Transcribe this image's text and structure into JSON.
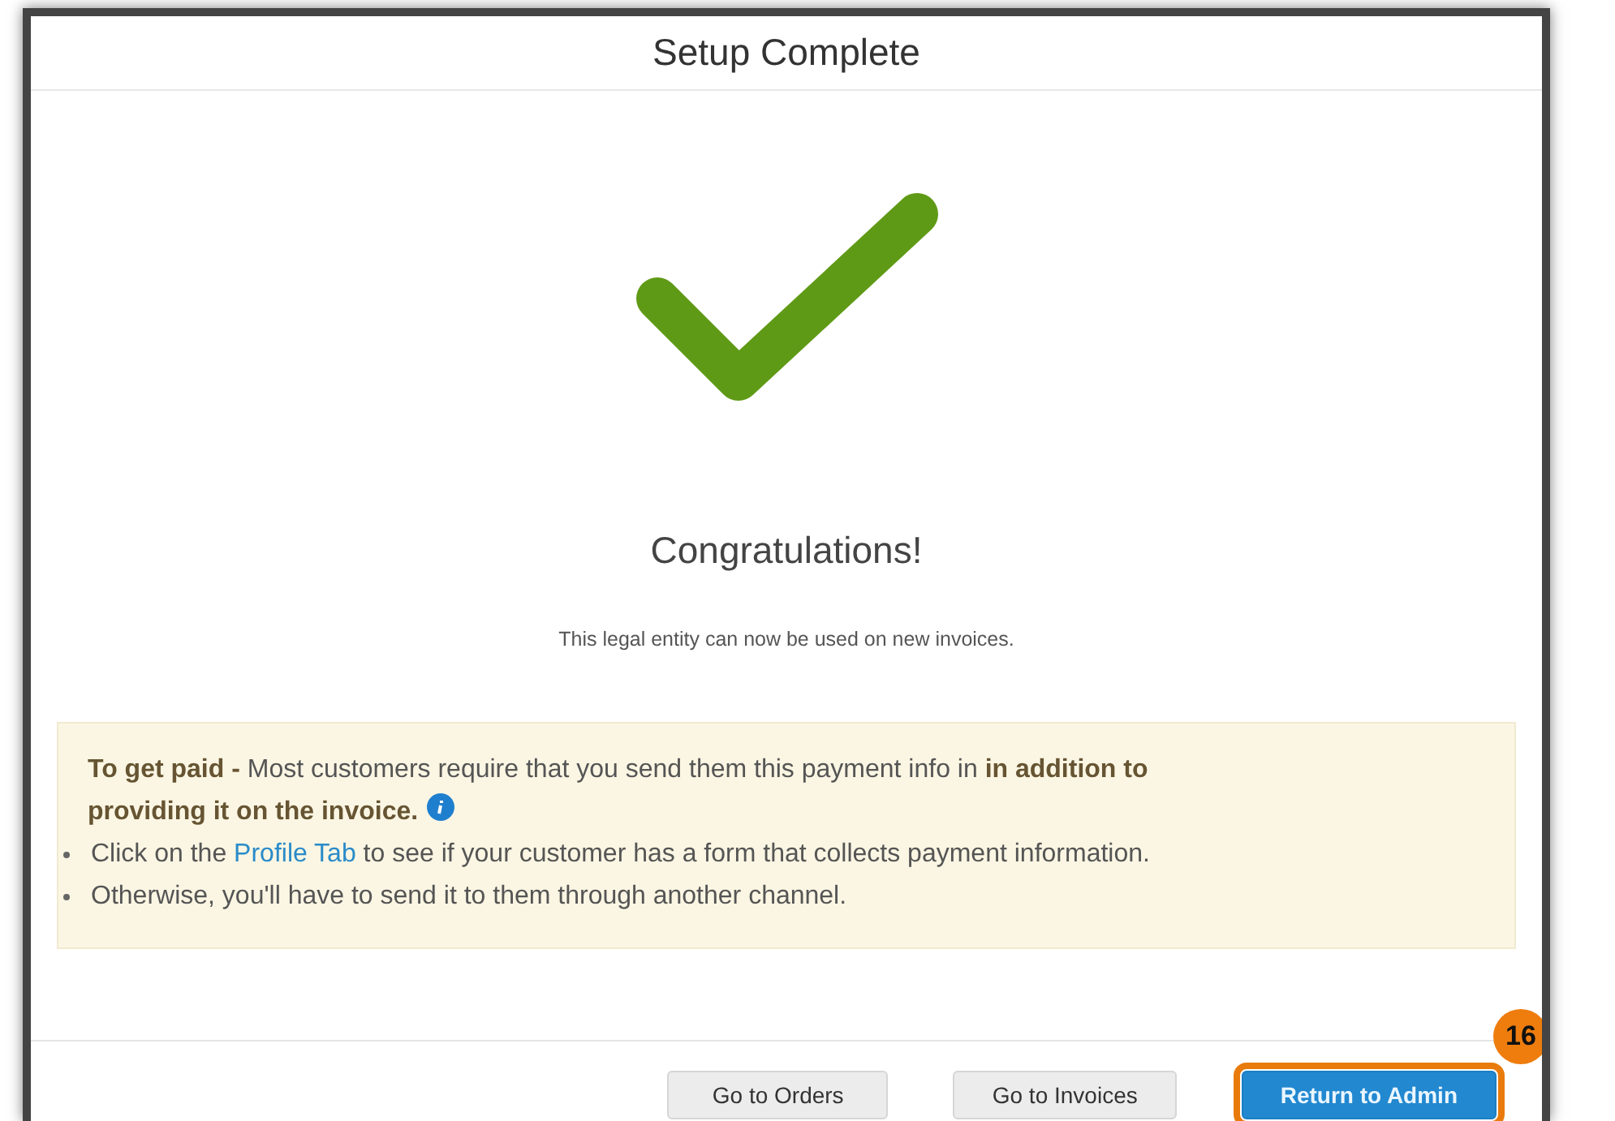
{
  "dialog": {
    "title": "Setup Complete"
  },
  "heading": "Congratulations!",
  "subtext": "This legal entity can now be used on new invoices.",
  "notice": {
    "lines": [
      "**To get paid -** Most customers require that you send them this payment info in **in addition to**",
      "**providing it on the invoice.**"
    ],
    "bullets": [
      {
        "before": "Click on the ",
        "link": "Profile Tab",
        "after": " to see if your customer has a form that collects payment information."
      },
      {
        "before": "Otherwise, you'll have to send it to them through another channel."
      }
    ]
  },
  "buttons": [
    {
      "label": "Go to Orders",
      "kind": "secondary",
      "highlighted": false
    },
    {
      "label": "Go to Invoices",
      "kind": "secondary",
      "highlighted": false
    },
    {
      "label": "Return to Admin",
      "kind": "primary",
      "highlighted": true,
      "step": "16"
    }
  ]
}
